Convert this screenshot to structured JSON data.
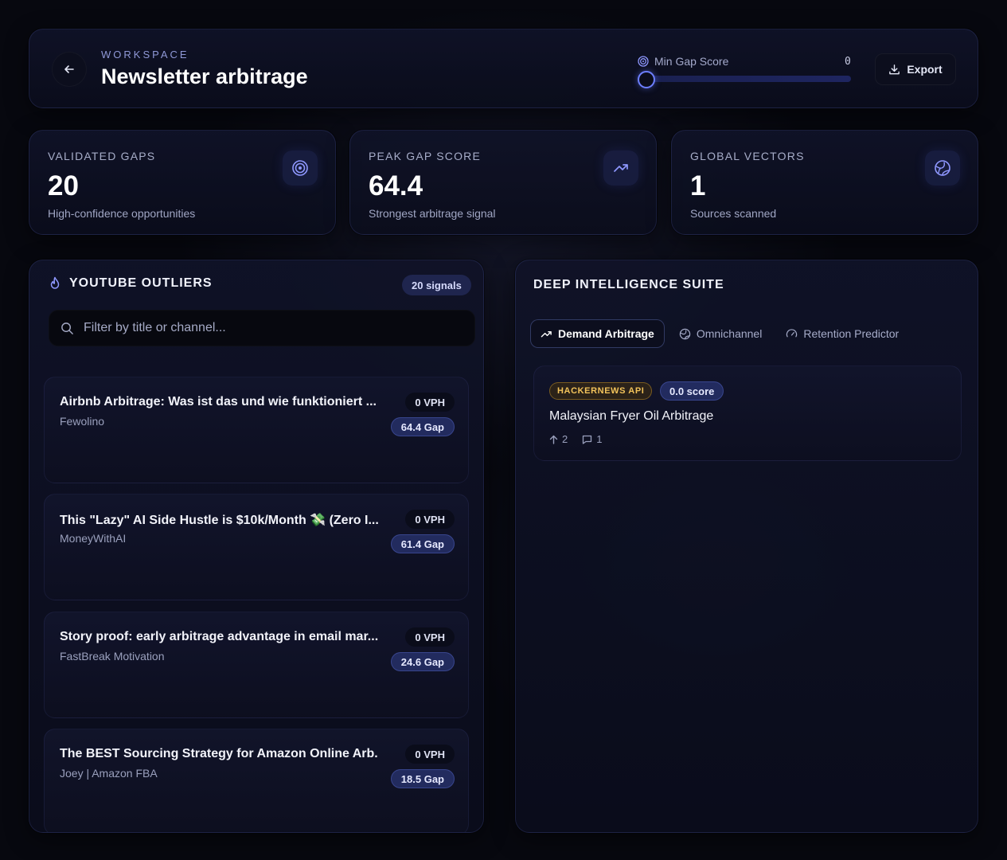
{
  "header": {
    "workspace_label": "WORKSPACE",
    "title": "Newsletter arbitrage",
    "min_gap_label": "Min Gap Score",
    "min_gap_value": "0",
    "export_label": "Export"
  },
  "stats": [
    {
      "label": "VALIDATED GAPS",
      "value": "20",
      "caption": "High-confidence opportunities",
      "icon": "target-icon"
    },
    {
      "label": "PEAK GAP SCORE",
      "value": "64.4",
      "caption": "Strongest arbitrage signal",
      "icon": "trending-up-icon"
    },
    {
      "label": "GLOBAL VECTORS",
      "value": "1",
      "caption": "Sources scanned",
      "icon": "globe-icon"
    }
  ],
  "outliers": {
    "title": "YOUTUBE OUTLIERS",
    "signals": "20 signals",
    "filter_placeholder": "Filter by title or channel...",
    "items": [
      {
        "title": "Airbnb Arbitrage: Was ist das und wie funktioniert ...",
        "channel": "Fewolino",
        "vph": "0 VPH",
        "gap": "64.4 Gap"
      },
      {
        "title": "This \"Lazy\" AI Side Hustle is $10k/Month 💸 (Zero I...",
        "channel": "MoneyWithAI",
        "vph": "0 VPH",
        "gap": "61.4 Gap"
      },
      {
        "title": "Story proof: early arbitrage advantage in email mar...",
        "channel": "FastBreak Motivation",
        "vph": "0 VPH",
        "gap": "24.6 Gap"
      },
      {
        "title": "The BEST Sourcing Strategy for Amazon Online Arb...",
        "channel": "Joey | Amazon FBA",
        "vph": "0 VPH",
        "gap": "18.5 Gap"
      }
    ]
  },
  "suite": {
    "title": "DEEP INTELLIGENCE SUITE",
    "tabs": [
      {
        "label": "Demand Arbitrage",
        "icon": "trending-up-icon",
        "active": true
      },
      {
        "label": "Omnichannel",
        "icon": "globe-icon",
        "active": false
      },
      {
        "label": "Retention Predictor",
        "icon": "gauge-icon",
        "active": false
      }
    ],
    "card": {
      "source": "HACKERNEWS API",
      "score": "0.0 score",
      "title": "Malaysian Fryer Oil Arbitrage",
      "upvotes": "2",
      "comments": "1"
    }
  },
  "colors": {
    "accent": "#6d7fff",
    "background": "#07080f",
    "source_badge": "#f2c35a"
  }
}
